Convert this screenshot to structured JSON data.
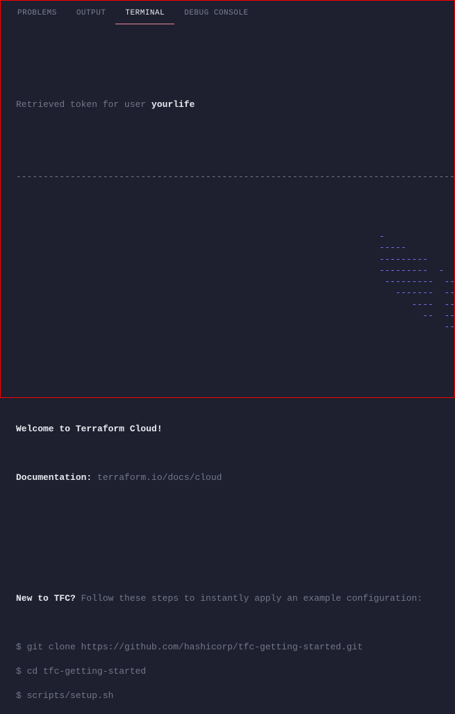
{
  "tabs": {
    "problems": "PROBLEMS",
    "output": "OUTPUT",
    "terminal": "TERMINAL",
    "debug": "DEBUG CONSOLE"
  },
  "token_line_prefix": "Retrieved token for user ",
  "username": "yourlife",
  "separator": "---------------------------------------------------------------------------------",
  "ascii_art": "                          -\n                          -----                           -\n                          ---------                      --\n                          ---------  -                -----\n                           ---------  ------        -------\n                             -------  ---------  ----------\n                                ----  ---------- ----------\n                                  --  ---------- ----------\n                                      ---  ----- ---------\n                                          --     ---------\n                                             -------   -\n                                             --------\n                                             ---------\n                                              ---------\n                                                -------\n                                                  -----\n                                                    -",
  "welcome": "Welcome to Terraform Cloud!",
  "doc_label": "Documentation:",
  "doc_url": "terraform.io/docs/cloud",
  "newto_label": "New to TFC?",
  "newto_rest": " Follow these steps to instantly apply an example configuration:",
  "cmd1": "$ git clone https://github.com/hashicorp/tfc-getting-started.git",
  "cmd2": "$ cd tfc-getting-started",
  "cmd3": "$ scripts/setup.sh"
}
